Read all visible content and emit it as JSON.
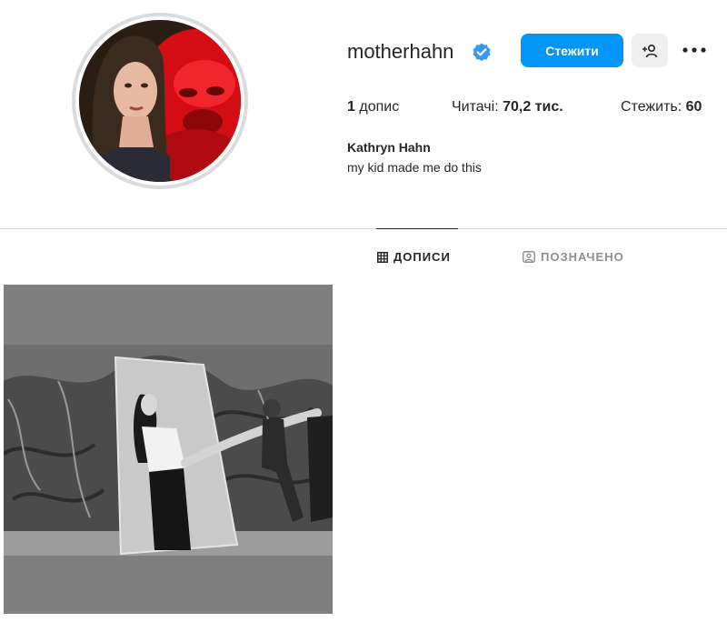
{
  "profile": {
    "username": "motherhahn",
    "verified": true,
    "full_name": "Kathryn Hahn",
    "bio": "my kid made me do this"
  },
  "actions": {
    "follow_label": "Стежити",
    "suggest_icon": "person-add-icon",
    "more_icon": "more-horizontal-icon"
  },
  "stats": {
    "posts_count": "1",
    "posts_label": "допис",
    "followers_label": "Читачі:",
    "followers_count": "70,2 тис.",
    "following_label": "Стежить:",
    "following_count": "60"
  },
  "tabs": [
    {
      "label": "ДОПИСИ",
      "icon": "grid-icon",
      "active": true
    },
    {
      "label": "ПОЗНАЧЕНО",
      "icon": "tagged-icon",
      "active": false
    }
  ],
  "colors": {
    "accent": "#0095f6",
    "verified_badge": "#3897f0",
    "text": "#262626",
    "muted": "#8e8e8e"
  }
}
